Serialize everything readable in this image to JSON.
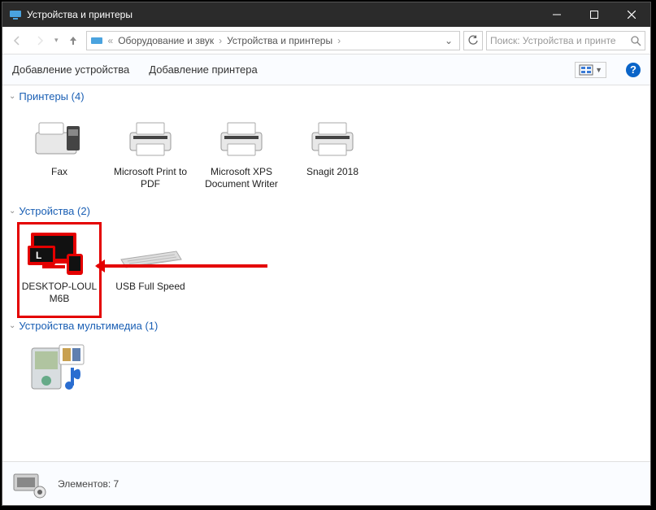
{
  "window": {
    "title": "Устройства и принтеры"
  },
  "breadcrumb": {
    "items": [
      "Оборудование и звук",
      "Устройства и принтеры"
    ]
  },
  "search": {
    "placeholder": "Поиск: Устройства и принте"
  },
  "toolbar": {
    "add_device": "Добавление устройства",
    "add_printer": "Добавление принтера"
  },
  "groups": [
    {
      "title": "Принтеры (4)",
      "type": "printers",
      "items": [
        {
          "label": "Fax",
          "icon": "fax"
        },
        {
          "label": "Microsoft Print to PDF",
          "icon": "printer"
        },
        {
          "label": "Microsoft XPS Document Writer",
          "icon": "printer"
        },
        {
          "label": "Snagit 2018",
          "icon": "printer"
        }
      ]
    },
    {
      "title": "Устройства (2)",
      "type": "devices",
      "items": [
        {
          "label": "DESKTOP-LOUL M6B",
          "icon": "computer-red",
          "highlighted": true
        },
        {
          "label": "USB Full Speed",
          "icon": "keyboard"
        }
      ]
    },
    {
      "title": "Устройства мультимедиа (1)",
      "type": "multimedia",
      "items": [
        {
          "label": "",
          "icon": "media-device"
        }
      ]
    }
  ],
  "status": {
    "count_label": "Элементов: 7"
  }
}
